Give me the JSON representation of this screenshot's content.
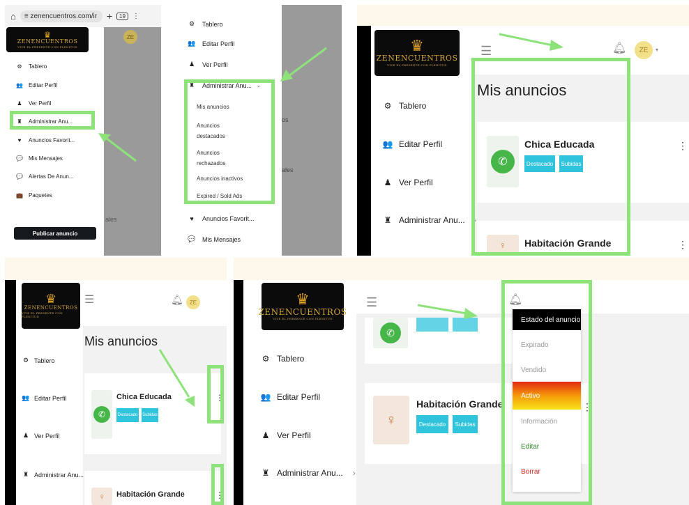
{
  "brand": {
    "logo_text": "ZENENCUENTROS",
    "tagline": "VIVE EL PRESENTE CON PLENITUD",
    "avatar_initials": "ZE",
    "accent_green": "#8de37a",
    "tag_color": "#2fc4dc"
  },
  "browser": {
    "url": "zenencuentros.com/ir",
    "tab_count": "19"
  },
  "sidebar": {
    "items": [
      {
        "label": "Tablero",
        "icon": "dashboard-icon"
      },
      {
        "label": "Editar Perfil",
        "icon": "users-icon"
      },
      {
        "label": "Ver Perfil",
        "icon": "user-icon"
      },
      {
        "label": "Administrar Anu...",
        "icon": "manage-ads-icon"
      },
      {
        "label": "Anuncios Favorit...",
        "icon": "heart-icon"
      },
      {
        "label": "Mis Mensajes",
        "icon": "chat-icon"
      },
      {
        "label": "Alertas De Anun...",
        "icon": "alert-chat-icon"
      },
      {
        "label": "Paquetes",
        "icon": "briefcase-icon"
      }
    ],
    "publish_button": "Publicar anuncio",
    "background_fragments": [
      "os",
      "ales",
      "ales"
    ]
  },
  "submenu": {
    "items": [
      "Mis anuncios",
      "Anuncios destacados",
      "Anuncios rechazados",
      "Anuncios inactivos",
      "Expired / Sold Ads"
    ]
  },
  "main": {
    "page_title": "Mis anuncios",
    "ads": [
      {
        "title": "Chica Educada",
        "tags": [
          "Destacado",
          "Subidas"
        ]
      },
      {
        "title": "Habitación Grande",
        "tags": [
          "Destacado",
          "Subidas"
        ]
      }
    ]
  },
  "status_menu": {
    "header": "Estado del anuncio",
    "items": [
      {
        "label": "Expirado",
        "state": "muted"
      },
      {
        "label": "Vendido",
        "state": "muted"
      },
      {
        "label": "Activo",
        "state": "active"
      },
      {
        "label": "Información",
        "state": "muted"
      },
      {
        "label": "Editar",
        "state": "edit"
      },
      {
        "label": "Borrar",
        "state": "delete"
      }
    ]
  }
}
